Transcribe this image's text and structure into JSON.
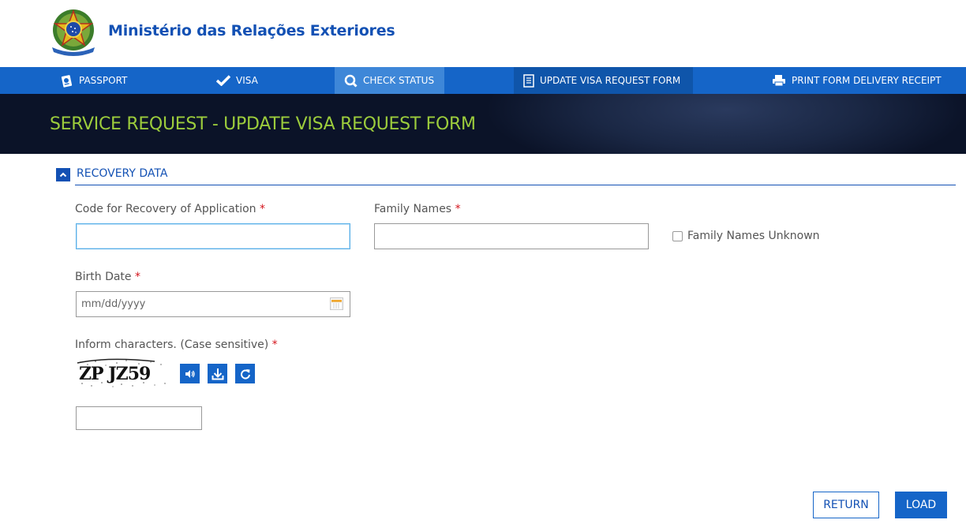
{
  "header": {
    "site_title": "Ministério das Relações Exteriores",
    "logo": "brazil-coat-of-arms"
  },
  "nav": {
    "items": [
      {
        "label": "PASSPORT",
        "icon": "passport-icon"
      },
      {
        "label": "VISA",
        "icon": "check-icon"
      },
      {
        "label": "CHECK STATUS",
        "icon": "search-icon",
        "state": "hover"
      },
      {
        "label": "UPDATE VISA REQUEST FORM",
        "icon": "document-icon",
        "state": "active"
      },
      {
        "label": "PRINT FORM DELIVERY RECEIPT",
        "icon": "printer-icon"
      }
    ]
  },
  "banner": {
    "title": "SERVICE REQUEST - UPDATE VISA REQUEST FORM"
  },
  "section": {
    "title": "RECOVERY DATA",
    "collapse_icon": "chevron-up-icon"
  },
  "form": {
    "recovery_code": {
      "label": "Code for Recovery of Application",
      "required": "*",
      "value": "",
      "placeholder": ""
    },
    "family_names": {
      "label": "Family Names",
      "required": "*",
      "value": "",
      "placeholder": ""
    },
    "family_names_unknown": {
      "label": "Family Names Unknown",
      "checked": false
    },
    "birth_date": {
      "label": "Birth Date",
      "required": "*",
      "value": "",
      "placeholder": "mm/dd/yyyy"
    },
    "captcha": {
      "label": "Inform characters. (Case sensitive)",
      "required": "*",
      "image_text": "ZP JZ59",
      "buttons": [
        "audio-icon",
        "download-icon",
        "refresh-icon"
      ],
      "value": "",
      "placeholder": ""
    }
  },
  "actions": {
    "return_label": "RETURN",
    "load_label": "LOAD"
  },
  "colors": {
    "brand_blue": "#1565c8",
    "title_blue": "#1351b4",
    "banner_title": "#9ccc3c",
    "required": "#d4141c"
  }
}
